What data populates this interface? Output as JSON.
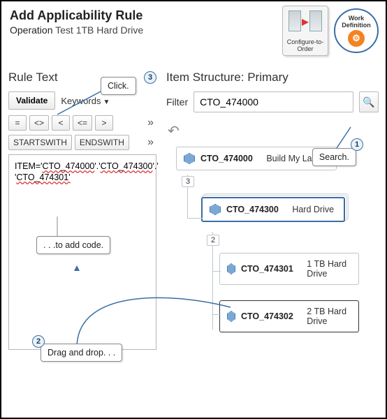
{
  "header": {
    "title": "Add Applicability Rule",
    "operation_label": "Operation",
    "operation_value": "Test 1TB Hard Drive"
  },
  "badges": {
    "cto_label": "Configure-to-Order",
    "wd_label": "Work Definition"
  },
  "left": {
    "section_title": "Rule Text",
    "validate_label": "Validate",
    "keywords_label": "Keywords",
    "ops": {
      "eq": "=",
      "ne": "<>",
      "lt": "<",
      "le": "<=",
      "gt": ">"
    },
    "fn": {
      "starts": "STARTSWITH",
      "ends": "ENDSWITH"
    },
    "rule_line1_prefix": "ITEM='",
    "rule_tok1": "CTO_474000",
    "rule_sep": "'.'",
    "rule_tok2": "CTO_474300",
    "rule_line1_suffix": "'.'",
    "rule_line2": "CTO_474301'",
    "chevron": "»"
  },
  "right": {
    "section_title": "Item Structure: Primary",
    "filter_label": "Filter",
    "filter_value": "CTO_474000",
    "undo_glyph": "↶",
    "nodes": {
      "root": {
        "id": "CTO_474000",
        "name": "Build My Laptop",
        "count": "3"
      },
      "hd": {
        "id": "CTO_474300",
        "name": "Hard Drive",
        "count": "2"
      },
      "hd1": {
        "id": "CTO_474301",
        "name": "1 TB Hard Drive"
      },
      "hd2": {
        "id": "CTO_474302",
        "name": "2 TB Hard Drive"
      }
    }
  },
  "callouts": {
    "click": "Click.",
    "search": "Search.",
    "addcode": ". . .to add code.",
    "drag": "Drag and drop. . .",
    "n1": "1",
    "n2": "2",
    "n3": "3"
  }
}
